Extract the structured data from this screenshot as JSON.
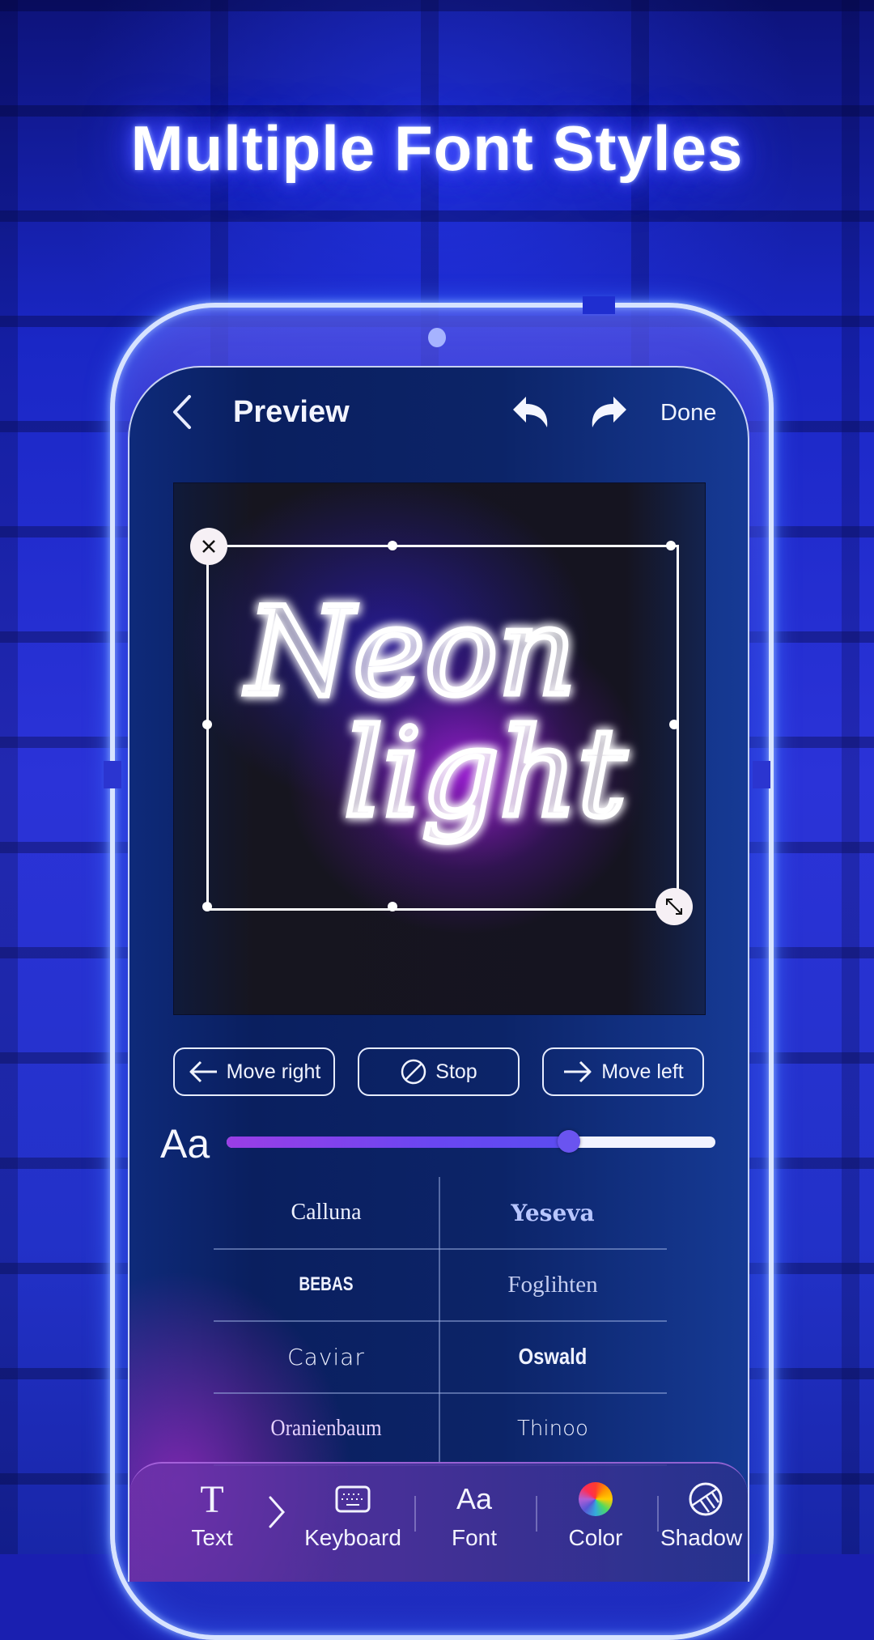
{
  "headline": "Multiple Font Styles",
  "app": {
    "title": "Preview",
    "back_icon": "chevron-left-icon",
    "undo_icon": "undo-icon",
    "redo_icon": "redo-icon",
    "done_label": "Done"
  },
  "canvas": {
    "text_line1": "Neon",
    "text_line2": "light",
    "close_icon": "close-icon",
    "resize_icon": "resize-diagonal-icon"
  },
  "move_buttons": [
    {
      "label": "Move right",
      "icon": "arrow-left-icon"
    },
    {
      "label": "Stop",
      "icon": "stop-circle-slash-icon"
    },
    {
      "label": "Move left",
      "icon": "arrow-right-icon"
    }
  ],
  "size_slider": {
    "label": "Aa",
    "value_fraction": 0.7
  },
  "fonts": [
    [
      "Calluna",
      "Yeseva"
    ],
    [
      "BEBAS",
      "Foglihten"
    ],
    [
      "Caviar",
      "Oswald"
    ],
    [
      "Oranienbaum",
      "Thinoo"
    ]
  ],
  "toolbar": {
    "items": [
      {
        "label": "Text",
        "icon": "text-t-icon"
      },
      {
        "label": "Keyboard",
        "icon": "keyboard-icon"
      },
      {
        "label": "Font",
        "icon": "font-aa-icon",
        "icon_text": "Aa"
      },
      {
        "label": "Color",
        "icon": "color-wheel-icon"
      },
      {
        "label": "Shadow",
        "icon": "shadow-icon"
      }
    ],
    "text_icon_glyph": "T",
    "chevron_icon": "chevron-right-icon"
  },
  "colors": {
    "background": "#1a27c6",
    "neon_glow": "#3a40ff",
    "slider_fill": "#6a46f2",
    "accent_purple": "#a02ee8"
  }
}
